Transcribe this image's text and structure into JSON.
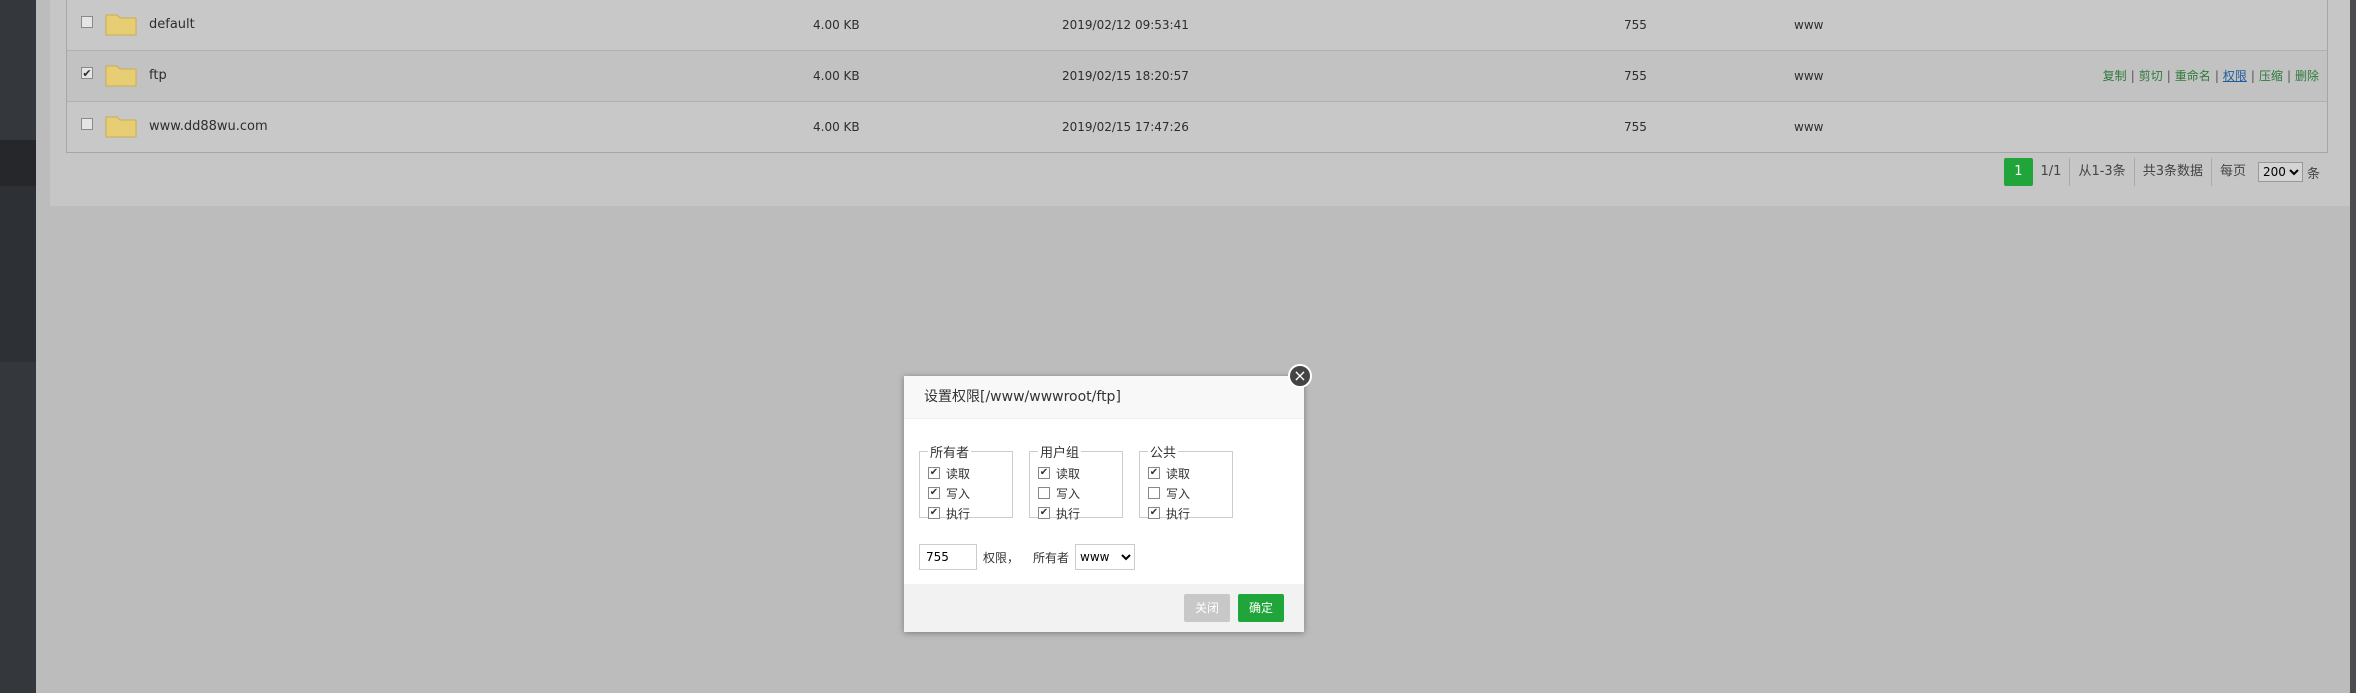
{
  "files": {
    "rows": [
      {
        "name": "default",
        "size": "4.00 KB",
        "mtime": "2019/02/12 09:53:41",
        "perm": "755",
        "owner": "www",
        "checked": false,
        "ops": []
      },
      {
        "name": "ftp",
        "size": "4.00 KB",
        "mtime": "2019/02/15 18:20:57",
        "perm": "755",
        "owner": "www",
        "checked": true,
        "ops": [
          "复制",
          "剪切",
          "重命名",
          "权限",
          "压缩",
          "删除"
        ]
      },
      {
        "name": "www.dd88wu.com",
        "size": "4.00 KB",
        "mtime": "2019/02/15 17:47:26",
        "perm": "755",
        "owner": "www",
        "checked": false,
        "ops": []
      }
    ]
  },
  "pager": {
    "current": "1",
    "pages": "1/1",
    "range": "从1-3条",
    "total": "共3条数据",
    "per_page_label": "每页",
    "per_page_value": "200",
    "unit": "条"
  },
  "dialog": {
    "title": "设置权限[/www/wwwroot/ftp]",
    "close_glyph": "×",
    "groups": [
      {
        "name": "所有者",
        "perms": [
          {
            "label": "读取",
            "checked": true
          },
          {
            "label": "写入",
            "checked": true
          },
          {
            "label": "执行",
            "checked": true
          }
        ]
      },
      {
        "name": "用户组",
        "perms": [
          {
            "label": "读取",
            "checked": true
          },
          {
            "label": "写入",
            "checked": false
          },
          {
            "label": "执行",
            "checked": true
          }
        ]
      },
      {
        "name": "公共",
        "perms": [
          {
            "label": "读取",
            "checked": true
          },
          {
            "label": "写入",
            "checked": false
          },
          {
            "label": "执行",
            "checked": true
          }
        ]
      }
    ],
    "perm_value": "755",
    "perm_label": "权限，",
    "owner_label": "所有者",
    "owner_value": "www",
    "cancel_label": "关闭",
    "ok_label": "确定"
  },
  "colors": {
    "accent": "#20a53a",
    "op_link": "#2f7a3c"
  },
  "icons": {
    "folder": "folder-icon",
    "close": "close-icon",
    "check": "check-icon"
  }
}
